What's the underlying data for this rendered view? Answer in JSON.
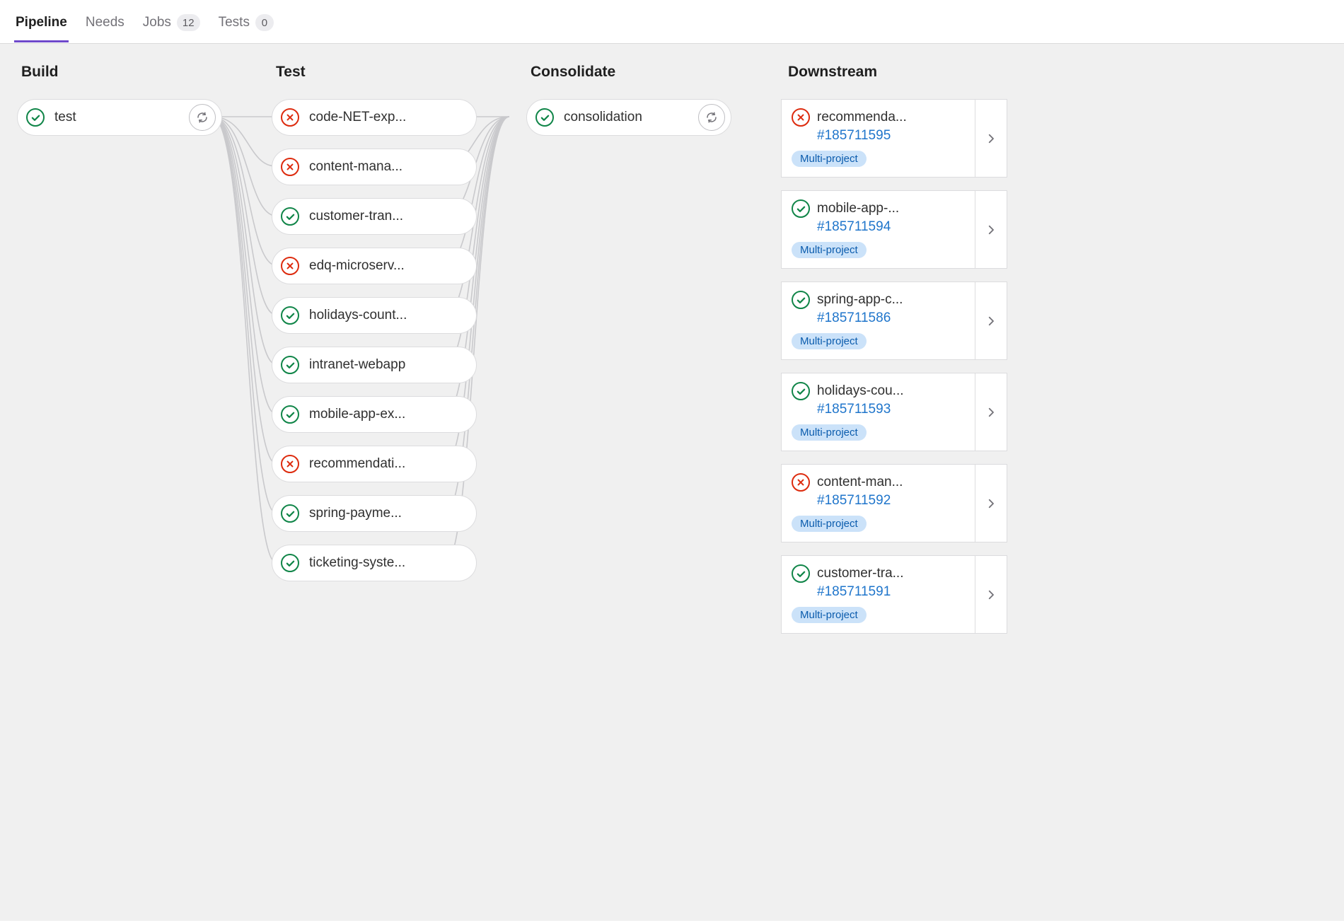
{
  "tabs": [
    {
      "key": "pipeline",
      "label": "Pipeline",
      "active": true
    },
    {
      "key": "needs",
      "label": "Needs",
      "active": false
    },
    {
      "key": "jobs",
      "label": "Jobs",
      "active": false,
      "count": "12"
    },
    {
      "key": "tests",
      "label": "Tests",
      "active": false,
      "count": "0"
    }
  ],
  "stages": {
    "build": {
      "title": "Build"
    },
    "test": {
      "title": "Test"
    },
    "consolidate": {
      "title": "Consolidate"
    },
    "downstream": {
      "title": "Downstream"
    }
  },
  "build_jobs": [
    {
      "name": "test",
      "status": "success",
      "retry": true
    }
  ],
  "test_jobs": [
    {
      "name": "code-NET-exp...",
      "status": "failed"
    },
    {
      "name": "content-mana...",
      "status": "failed"
    },
    {
      "name": "customer-tran...",
      "status": "success"
    },
    {
      "name": "edq-microserv...",
      "status": "failed"
    },
    {
      "name": "holidays-count...",
      "status": "success"
    },
    {
      "name": "intranet-webapp",
      "status": "success"
    },
    {
      "name": "mobile-app-ex...",
      "status": "success"
    },
    {
      "name": "recommendati...",
      "status": "failed"
    },
    {
      "name": "spring-payme...",
      "status": "success"
    },
    {
      "name": "ticketing-syste...",
      "status": "success"
    }
  ],
  "consolidate_jobs": [
    {
      "name": "consolidation",
      "status": "success",
      "retry": true
    }
  ],
  "downstream": [
    {
      "title": "recommenda...",
      "status": "failed",
      "pipeline_id": "#185711595",
      "tag": "Multi-project"
    },
    {
      "title": "mobile-app-...",
      "status": "success",
      "pipeline_id": "#185711594",
      "tag": "Multi-project"
    },
    {
      "title": "spring-app-c...",
      "status": "success",
      "pipeline_id": "#185711586",
      "tag": "Multi-project"
    },
    {
      "title": "holidays-cou...",
      "status": "success",
      "pipeline_id": "#185711593",
      "tag": "Multi-project"
    },
    {
      "title": "content-man...",
      "status": "failed",
      "pipeline_id": "#185711592",
      "tag": "Multi-project"
    },
    {
      "title": "customer-tra...",
      "status": "success",
      "pipeline_id": "#185711591",
      "tag": "Multi-project"
    }
  ]
}
